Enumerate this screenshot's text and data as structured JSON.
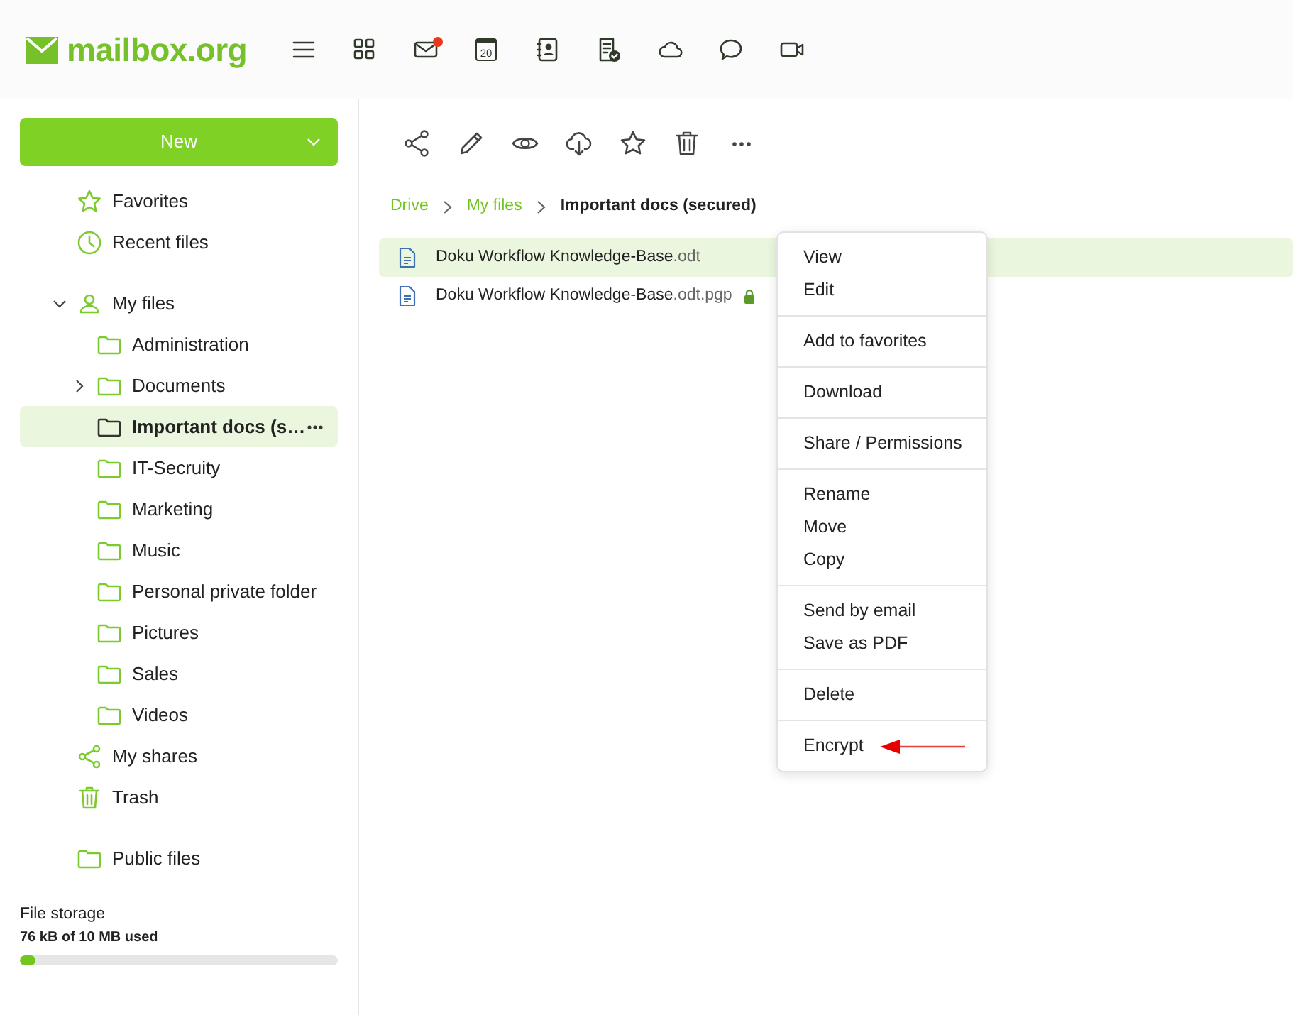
{
  "header": {
    "logo": "mailbox.org",
    "apps": [
      {
        "kind": "menu",
        "notification": false
      },
      {
        "kind": "grid",
        "notification": false
      },
      {
        "kind": "mail",
        "notification": true
      },
      {
        "kind": "calendar",
        "notification": false,
        "label": "20"
      },
      {
        "kind": "contacts",
        "notification": false
      },
      {
        "kind": "tasks",
        "notification": false
      },
      {
        "kind": "cloud",
        "notification": false
      },
      {
        "kind": "chat",
        "notification": false
      },
      {
        "kind": "video",
        "notification": false
      }
    ]
  },
  "sidebar": {
    "new_button": {
      "label": "New"
    },
    "sections": [
      {
        "items": [
          {
            "kind": "star",
            "label": "Favorites",
            "selected": false
          },
          {
            "kind": "clock",
            "label": "Recent files",
            "selected": false
          }
        ]
      },
      {
        "items": [
          {
            "kind": "person",
            "label": "My files",
            "selected": false,
            "expanded": true,
            "children": [
              {
                "kind": "folder",
                "label": "Administration",
                "selected": false
              },
              {
                "kind": "folder",
                "label": "Documents",
                "selected": false,
                "expanded": false,
                "has_children": true
              },
              {
                "kind": "folder",
                "label": "Important docs (s…",
                "selected": true
              },
              {
                "kind": "folder",
                "label": "IT-Secruity",
                "selected": false
              },
              {
                "kind": "folder",
                "label": "Marketing",
                "selected": false
              },
              {
                "kind": "folder",
                "label": "Music",
                "selected": false
              },
              {
                "kind": "folder",
                "label": "Personal private folder",
                "selected": false
              },
              {
                "kind": "folder",
                "label": "Pictures",
                "selected": false
              },
              {
                "kind": "folder",
                "label": "Sales",
                "selected": false
              },
              {
                "kind": "folder",
                "label": "Videos",
                "selected": false
              }
            ]
          },
          {
            "kind": "share",
            "label": "My shares",
            "selected": false
          },
          {
            "kind": "trash",
            "label": "Trash",
            "selected": false
          }
        ]
      },
      {
        "items": [
          {
            "kind": "folder",
            "label": "Public files",
            "selected": false
          }
        ]
      }
    ],
    "storage": {
      "title": "File storage",
      "usage": "76 kB of 10 MB used",
      "level": 0.05
    }
  },
  "toolbar": [
    {
      "kind": "share"
    },
    {
      "kind": "edit"
    },
    {
      "kind": "view"
    },
    {
      "kind": "download"
    },
    {
      "kind": "favorite"
    },
    {
      "kind": "delete"
    },
    {
      "kind": "more"
    }
  ],
  "breadcrumb": [
    {
      "label": "Drive",
      "current": false
    },
    {
      "label": "My files",
      "current": false
    },
    {
      "label": "Important docs (secured)",
      "current": true
    }
  ],
  "files": [
    {
      "name": "Doku Workflow Knowledge-Base",
      "extension": ".odt",
      "selected": true,
      "locked": false
    },
    {
      "name": "Doku Workflow Knowledge-Base",
      "extension": ".odt.pgp",
      "selected": false,
      "locked": true
    }
  ],
  "context_menu": {
    "groups": [
      {
        "items": [
          {
            "label": "View",
            "pointed": false
          },
          {
            "label": "Edit",
            "pointed": false
          }
        ]
      },
      {
        "items": [
          {
            "label": "Add to favorites",
            "pointed": false
          }
        ]
      },
      {
        "items": [
          {
            "label": "Download",
            "pointed": false
          }
        ]
      },
      {
        "items": [
          {
            "label": "Share / Permissions",
            "pointed": false
          }
        ]
      },
      {
        "items": [
          {
            "label": "Rename",
            "pointed": false
          },
          {
            "label": "Move",
            "pointed": false
          },
          {
            "label": "Copy",
            "pointed": false
          }
        ]
      },
      {
        "items": [
          {
            "label": "Send by email",
            "pointed": false
          },
          {
            "label": "Save as PDF",
            "pointed": false
          }
        ]
      },
      {
        "items": [
          {
            "label": "Delete",
            "pointed": false
          }
        ]
      },
      {
        "items": [
          {
            "label": "Encrypt",
            "pointed": true
          }
        ]
      }
    ]
  }
}
